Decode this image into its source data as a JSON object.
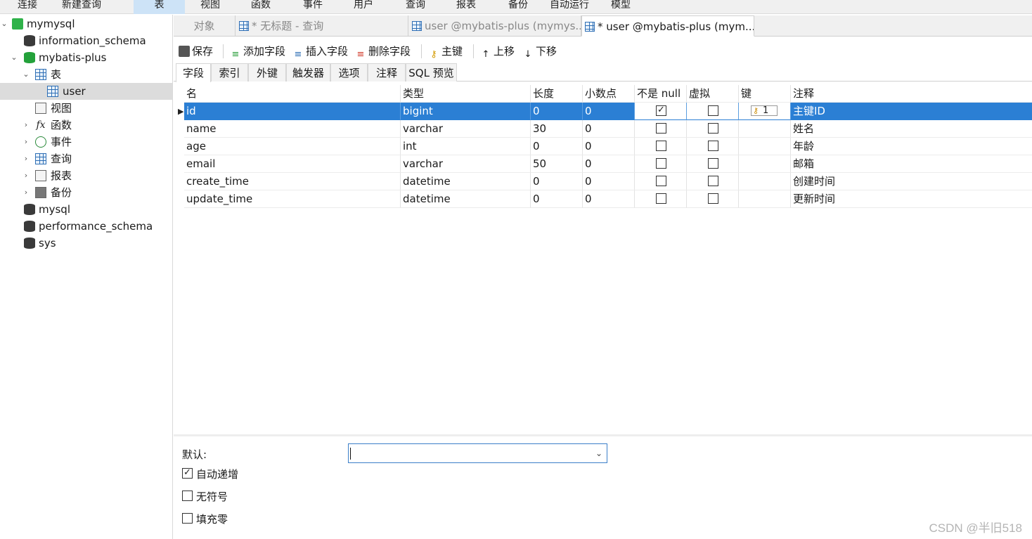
{
  "menu": [
    "连接",
    "新建查询",
    "表",
    "视图",
    "函数",
    "事件",
    "用户",
    "查询",
    "报表",
    "备份",
    "自动运行",
    "模型"
  ],
  "menu_active_index": 2,
  "tree": {
    "connection": "mymysql",
    "databases_top": [
      "information_schema",
      "mybatis-plus"
    ],
    "tables_node": "表",
    "selected_table": "user",
    "other_nodes": [
      "视图",
      "函数",
      "事件",
      "查询",
      "报表",
      "备份"
    ],
    "databases_bottom": [
      "mysql",
      "performance_schema",
      "sys"
    ]
  },
  "tabs": [
    "对象",
    "* 无标题 - 查询",
    "user @mybatis-plus (mymys...",
    "* user @mybatis-plus (mym..."
  ],
  "toolbar": {
    "save": "保存",
    "add_field": "添加字段",
    "insert_field": "插入字段",
    "delete_field": "删除字段",
    "primary_key": "主键",
    "move_up": "上移",
    "move_down": "下移"
  },
  "subtabs": [
    "字段",
    "索引",
    "外键",
    "触发器",
    "选项",
    "注释",
    "SQL 预览"
  ],
  "grid": {
    "headers": [
      "名",
      "类型",
      "长度",
      "小数点",
      "不是 null",
      "虚拟",
      "键",
      "注释"
    ],
    "rows": [
      {
        "name": "id",
        "type": "bigint",
        "length": "0",
        "decimals": "0",
        "not_null": true,
        "virtual": false,
        "key": "1",
        "comment": "主键ID"
      },
      {
        "name": "name",
        "type": "varchar",
        "length": "30",
        "decimals": "0",
        "not_null": false,
        "virtual": false,
        "key": "",
        "comment": "姓名"
      },
      {
        "name": "age",
        "type": "int",
        "length": "0",
        "decimals": "0",
        "not_null": false,
        "virtual": false,
        "key": "",
        "comment": "年龄"
      },
      {
        "name": "email",
        "type": "varchar",
        "length": "50",
        "decimals": "0",
        "not_null": false,
        "virtual": false,
        "key": "",
        "comment": "邮箱"
      },
      {
        "name": "create_time",
        "type": "datetime",
        "length": "0",
        "decimals": "0",
        "not_null": false,
        "virtual": false,
        "key": "",
        "comment": "创建时间"
      },
      {
        "name": "update_time",
        "type": "datetime",
        "length": "0",
        "decimals": "0",
        "not_null": false,
        "virtual": false,
        "key": "",
        "comment": "更新时间"
      }
    ]
  },
  "bottom": {
    "default_label": "默认:",
    "default_value": "",
    "auto_increment": "自动递增",
    "auto_increment_checked": true,
    "unsigned": "无符号",
    "unsigned_checked": false,
    "zerofill": "填充零",
    "zerofill_checked": false
  },
  "watermark": "CSDN @半旧518",
  "colors": {
    "selection": "#2b7fd4",
    "active_menu": "#cde3f7",
    "db_green": "#23a13a"
  }
}
